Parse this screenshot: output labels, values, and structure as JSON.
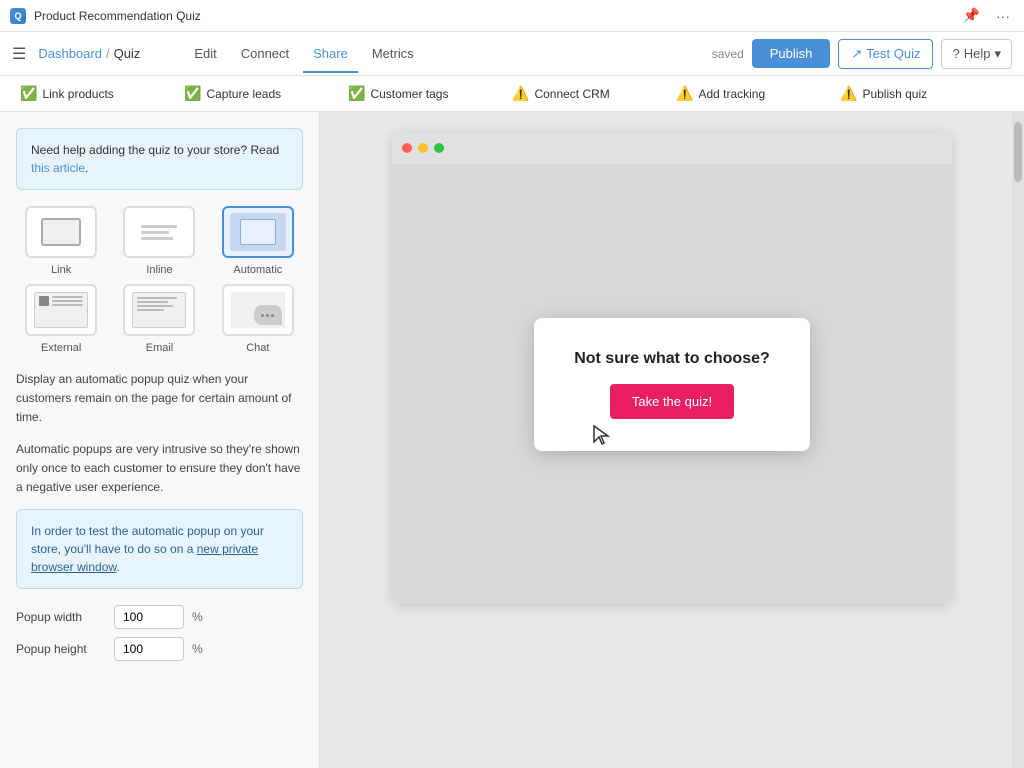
{
  "titleBar": {
    "appName": "Product Recommendation Quiz",
    "pinIcon": "📌",
    "moreIcon": "···"
  },
  "navBar": {
    "hamburgerIcon": "☰",
    "breadcrumb": {
      "dashboard": "Dashboard",
      "separator": "/",
      "current": "Quiz"
    },
    "tabs": [
      {
        "id": "edit",
        "label": "Edit"
      },
      {
        "id": "connect",
        "label": "Connect"
      },
      {
        "id": "share",
        "label": "Share",
        "active": true
      },
      {
        "id": "metrics",
        "label": "Metrics"
      }
    ],
    "savedText": "saved",
    "publishLabel": "Publish",
    "testQuizLabel": "Test Quiz",
    "helpLabel": "Help"
  },
  "checklistBar": {
    "items": [
      {
        "id": "link-products",
        "label": "Link products",
        "status": "success"
      },
      {
        "id": "capture-leads",
        "label": "Capture leads",
        "status": "success"
      },
      {
        "id": "customer-tags",
        "label": "Customer tags",
        "status": "success"
      },
      {
        "id": "connect-crm",
        "label": "Connect CRM",
        "status": "warning"
      },
      {
        "id": "add-tracking",
        "label": "Add tracking",
        "status": "warning"
      },
      {
        "id": "publish-quiz",
        "label": "Publish quiz",
        "status": "warning"
      }
    ]
  },
  "sidebar": {
    "infoBox": {
      "text": "Need help adding the quiz to your store? Read ",
      "linkText": "this article",
      "textAfter": "."
    },
    "modes": [
      {
        "id": "link",
        "label": "Link",
        "active": false
      },
      {
        "id": "inline",
        "label": "Inline",
        "active": false
      },
      {
        "id": "automatic",
        "label": "Automatic",
        "active": true
      },
      {
        "id": "external",
        "label": "External",
        "active": false
      },
      {
        "id": "email",
        "label": "Email",
        "active": false
      },
      {
        "id": "chat",
        "label": "Chat",
        "active": false
      }
    ],
    "description1": "Display an automatic popup quiz when your customers remain on the page for certain amount of time.",
    "description2": "Automatic popups are very intrusive so they're shown only once to each customer to ensure they don't have a negative user experience.",
    "noteBox": "In order to test the automatic popup on your store, you'll have to do so on a ",
    "noteLinkText": "new private browser window",
    "noteTextAfter": ".",
    "formRows": [
      {
        "label": "Popup width",
        "value": "100",
        "unit": "%"
      },
      {
        "label": "Popup height",
        "value": "100",
        "unit": "%"
      }
    ]
  },
  "preview": {
    "popupTitle": "Not sure what to choose?",
    "popupButtonLabel": "Take the quiz!"
  },
  "colors": {
    "accent": "#4a90d9",
    "publish": "#4a90d9",
    "popupButton": "#e91e63",
    "success": "#4caf50",
    "warning": "#ff9800"
  }
}
